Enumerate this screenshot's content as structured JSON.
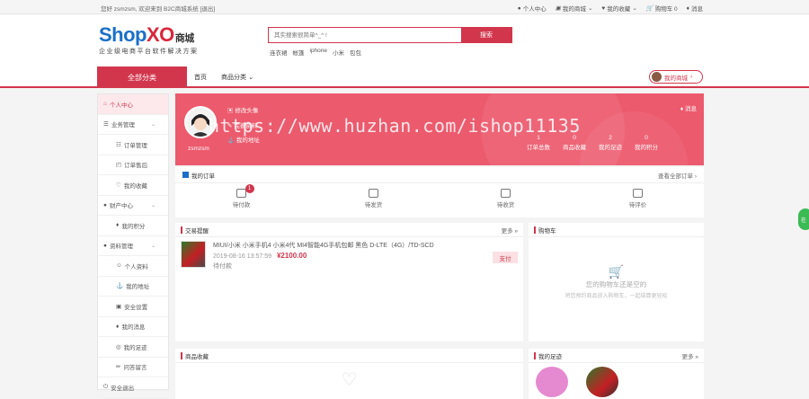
{
  "topbar": {
    "welcome": "您好 zsmzsm,  欢迎来到 B2C商城系统 [退出]",
    "nav": [
      "个人中心",
      "我的商城",
      "我的收藏",
      "购物车 0",
      "消息"
    ]
  },
  "header": {
    "logo_en_a": "Shop",
    "logo_en_b": "XO",
    "logo_cn": "商城",
    "slogan": "企业级电商平台软件解决方案",
    "search_placeholder": "其实搜索很简单^_^ !",
    "search_button": "搜索",
    "hotwords": [
      "连衣裙",
      "帐篷",
      "iphone",
      "小米",
      "包包"
    ]
  },
  "nav": {
    "all_categories": "全部分类",
    "links": [
      "首页",
      "商品分类"
    ],
    "my_store": "我的商城"
  },
  "sidebar": {
    "items": [
      {
        "label": "个人中心",
        "type": "top",
        "active": true
      },
      {
        "label": "业务管理",
        "type": "group"
      },
      {
        "label": "订单管理",
        "type": "sub"
      },
      {
        "label": "订单售后",
        "type": "sub"
      },
      {
        "label": "我的收藏",
        "type": "sub"
      },
      {
        "label": "财产中心",
        "type": "group"
      },
      {
        "label": "我的积分",
        "type": "sub"
      },
      {
        "label": "资料管理",
        "type": "group"
      },
      {
        "label": "个人资料",
        "type": "sub"
      },
      {
        "label": "我的地址",
        "type": "sub"
      },
      {
        "label": "安全设置",
        "type": "sub"
      },
      {
        "label": "我的消息",
        "type": "sub"
      },
      {
        "label": "我的足迹",
        "type": "sub"
      },
      {
        "label": "问答留言",
        "type": "sub"
      },
      {
        "label": "安全退出",
        "type": "top"
      }
    ]
  },
  "profile": {
    "username": "zsmzsm",
    "edit_avatar": "修改头像",
    "edit_profile": "完善资料",
    "my_address": "我的地址",
    "message": "消息",
    "stats": [
      {
        "value": "1",
        "label": "订单总数"
      },
      {
        "value": "0",
        "label": "商品收藏"
      },
      {
        "value": "2",
        "label": "我的足迹"
      },
      {
        "value": "0",
        "label": "我的积分"
      }
    ]
  },
  "watermark": "https://www.huzhan.com/ishop11135",
  "orders": {
    "title": "我的订单",
    "more": "查看全部订单",
    "statuses": [
      {
        "label": "待付款",
        "badge": "1"
      },
      {
        "label": "待发货",
        "badge": ""
      },
      {
        "label": "待收货",
        "badge": ""
      },
      {
        "label": "待评价",
        "badge": ""
      }
    ]
  },
  "trade": {
    "title": "交易提醒",
    "more": "更多",
    "item": {
      "name": "MIUI/小米 小米手机4 小米4代 MI4智能4G手机包邮 黑色 D-LTE（4G）/TD-SCD",
      "time": "2019-08-16 13:57:59",
      "price": "¥2100.00",
      "status": "待付款",
      "pay_button": "支付"
    }
  },
  "cart": {
    "title": "购物车",
    "empty_title": "您的购物车还是空的",
    "empty_desc": "将您预约商品放入购物车，一起结算更轻松"
  },
  "fav": {
    "title": "商品收藏"
  },
  "footprint": {
    "title": "我的足迹",
    "more": "更多"
  },
  "float_tab": "在"
}
